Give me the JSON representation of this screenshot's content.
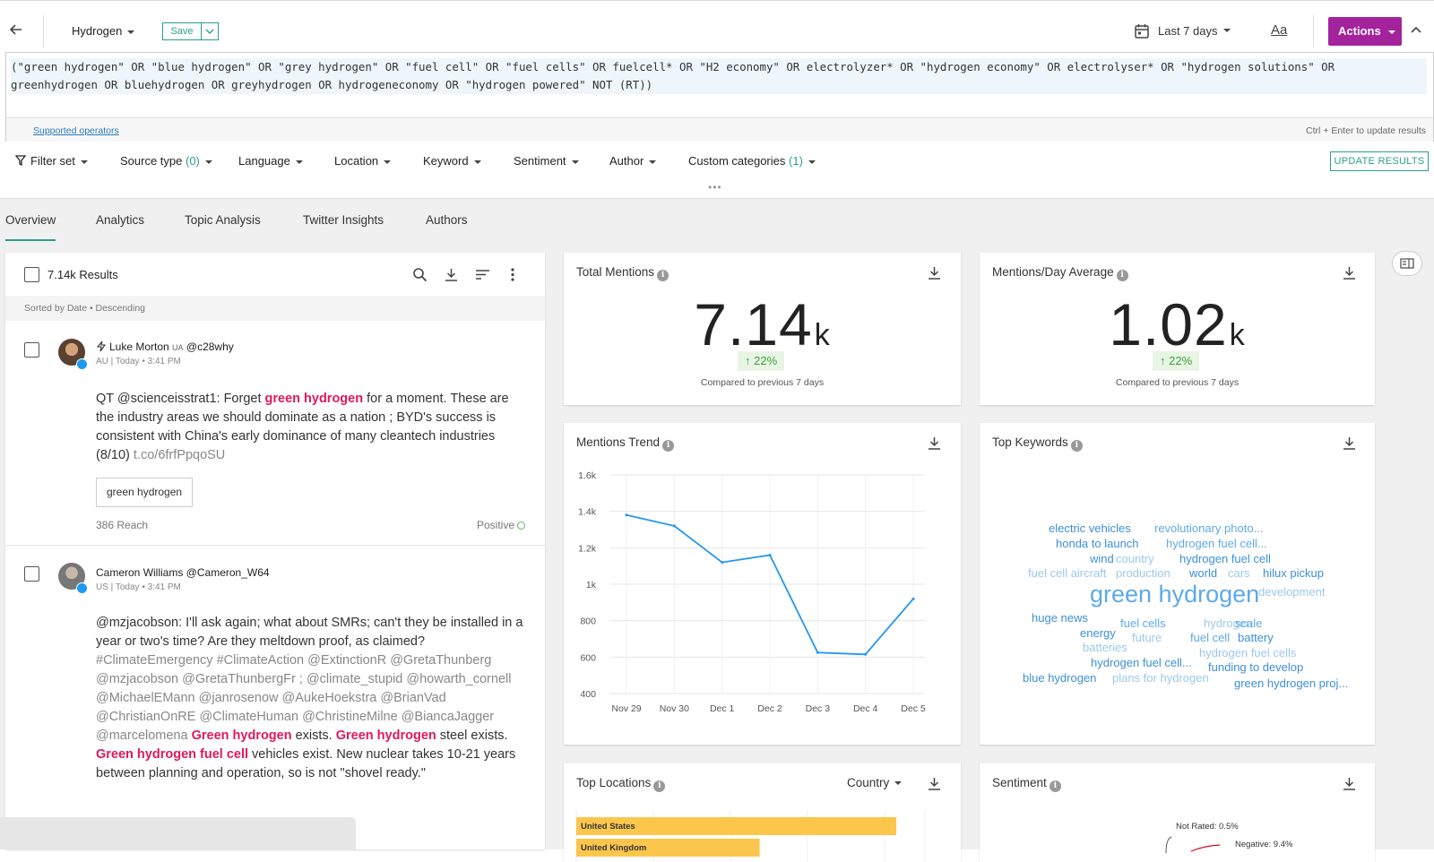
{
  "topbar": {
    "query_name": "Hydrogen",
    "save_label": "Save",
    "date_range": "Last 7 days",
    "font_label": "Aa",
    "actions_label": "Actions"
  },
  "query": {
    "text": "(\"green hydrogen\" OR \"blue hydrogen\" OR \"grey hydrogen\" OR \"fuel cell\" OR \"fuel cells\" OR fuelcell* OR \"H2 economy\" OR electrolyzer* OR \"hydrogen economy\" OR electrolyser* OR \"hydrogen solutions\" OR greenhydrogen OR bluehydrogen OR greyhydrogen OR hydrogeneconomy OR \"hydrogen powered\" NOT (RT))",
    "supported_link": "Supported operators",
    "hint": "Ctrl + Enter to update results"
  },
  "filters": {
    "filter_set": "Filter set",
    "source_type": "Source type",
    "source_type_count": "(0)",
    "language": "Language",
    "location": "Location",
    "keyword": "Keyword",
    "sentiment": "Sentiment",
    "author": "Author",
    "custom_categories": "Custom categories",
    "custom_categories_count": "(1)",
    "update_label": "UPDATE RESULTS"
  },
  "tabs": [
    "Overview",
    "Analytics",
    "Topic Analysis",
    "Twitter Insights",
    "Authors"
  ],
  "results": {
    "count_label": "7.14k Results",
    "sort_label": "Sorted by Date • Descending",
    "posts": [
      {
        "author": "Luke Morton",
        "flag": "UA",
        "handle": "@c28why",
        "meta": "AU |  Today • 3:41 PM",
        "text_a": "QT @scienceisstrat1: Forget ",
        "hl_a": "green hydrogen",
        "text_b": " for a moment. These are the industry areas we should dominate as a nation ; BYD's success is consistent with China's early dominance of many cleantech industries (8/10) ",
        "link": "t.co/6frfPpqoSU",
        "tag": "green hydrogen",
        "reach": "386 Reach",
        "sentiment": "Positive"
      },
      {
        "author": "Cameron Williams @Cameron_W64",
        "meta": "US |  Today • 3:41 PM",
        "text_a": "@mzjacobson: I'll ask again; what about SMRs; can't they be installed in a year or two's time? Are they meltdown proof, as claimed? ",
        "muted_a": "#ClimateEmergency #ClimateAction @ExtinctionR @GretaThunberg @mzjacobson @GretaThunbergFr ; @climate_stupid @howarth_cornell @MichaelEMann @janrosenow @AukeHoekstra @BrianVad @ChristianOnRE @ClimateHuman @ChristineMilne @BiancaJagger @marcelomena",
        "hl_a": "Green hydrogen",
        "text_b": " exists. ",
        "hl_b": "Green hydrogen",
        "text_c": " steel exists. ",
        "hl_c": "Green hydrogen fuel cell",
        "text_d": " vehicles exist. New nuclear takes 10-21 years between planning and operation, so is not \"shovel ready.\""
      }
    ]
  },
  "total_mentions": {
    "title": "Total Mentions",
    "value": "7.14",
    "unit": "k",
    "change": "22%",
    "compared": "Compared to previous 7 days"
  },
  "mentions_per_day": {
    "title": "Mentions/Day Average",
    "value": "1.02",
    "unit": "k",
    "change": "22%",
    "compared": "Compared to previous 7 days"
  },
  "mentions_trend": {
    "title": "Mentions Trend"
  },
  "chart_data": {
    "type": "line",
    "x": [
      "Nov 29",
      "Nov 30",
      "Dec 1",
      "Dec 2",
      "Dec 3",
      "Dec 4",
      "Dec 5"
    ],
    "values": [
      1380,
      1320,
      1120,
      1160,
      625,
      615,
      920
    ],
    "yticks": [
      "1.6k",
      "1.4k",
      "1.2k",
      "1k",
      "800",
      "600",
      "400"
    ],
    "ylim": [
      400,
      1600
    ],
    "grid": true,
    "color": "#2196f3"
  },
  "top_keywords": {
    "title": "Top Keywords",
    "words": [
      {
        "text": "electric vehicles",
        "tone": "mid"
      },
      {
        "text": "revolutionary photo...",
        "tone": "light"
      },
      {
        "text": "honda to launch",
        "tone": "mid"
      },
      {
        "text": "hydrogen fuel cell...",
        "tone": "light"
      },
      {
        "text": "wind",
        "tone": "mid"
      },
      {
        "text": "country",
        "tone": "pale"
      },
      {
        "text": "hydrogen fuel cell",
        "tone": "mid"
      },
      {
        "text": "fuel cell aircraft",
        "tone": "pale"
      },
      {
        "text": "production",
        "tone": "pale"
      },
      {
        "text": "world",
        "tone": "mid"
      },
      {
        "text": "cars",
        "tone": "pale"
      },
      {
        "text": "hilux pickup",
        "tone": "mid"
      },
      {
        "text": "green hydrogen",
        "tone": "light"
      },
      {
        "text": "development",
        "tone": "pale"
      },
      {
        "text": "huge news",
        "tone": "mid"
      },
      {
        "text": "fuel cells",
        "tone": "light"
      },
      {
        "text": "hydrogen",
        "tone": "pale"
      },
      {
        "text": "scale",
        "tone": "light"
      },
      {
        "text": "energy",
        "tone": "mid"
      },
      {
        "text": "future",
        "tone": "pale"
      },
      {
        "text": "fuel cell",
        "tone": "light"
      },
      {
        "text": "battery",
        "tone": "mid"
      },
      {
        "text": "batteries",
        "tone": "pale"
      },
      {
        "text": "hydrogen fuel cells",
        "tone": "pale"
      },
      {
        "text": "hydrogen fuel cell...",
        "tone": "mid"
      },
      {
        "text": "funding to develop",
        "tone": "mid"
      },
      {
        "text": "blue hydrogen",
        "tone": "mid"
      },
      {
        "text": "plans for hydrogen",
        "tone": "pale"
      },
      {
        "text": "green hydrogen proj...",
        "tone": "mid"
      }
    ]
  },
  "top_locations": {
    "title": "Top Locations",
    "group_by": "Country",
    "bars": [
      {
        "label": "United States",
        "fraction": 0.96
      },
      {
        "label": "United Kingdom",
        "fraction": 0.55
      }
    ]
  },
  "sentiment": {
    "title": "Sentiment",
    "labels": [
      "Not Rated: 0.5%",
      "Negative: 9.4%"
    ]
  },
  "colors": {
    "accent": "#2a9d8f",
    "actions": "#a3239d",
    "highlight": "#e0185d",
    "line": "#2196f3",
    "bar": "#fcc64d"
  }
}
